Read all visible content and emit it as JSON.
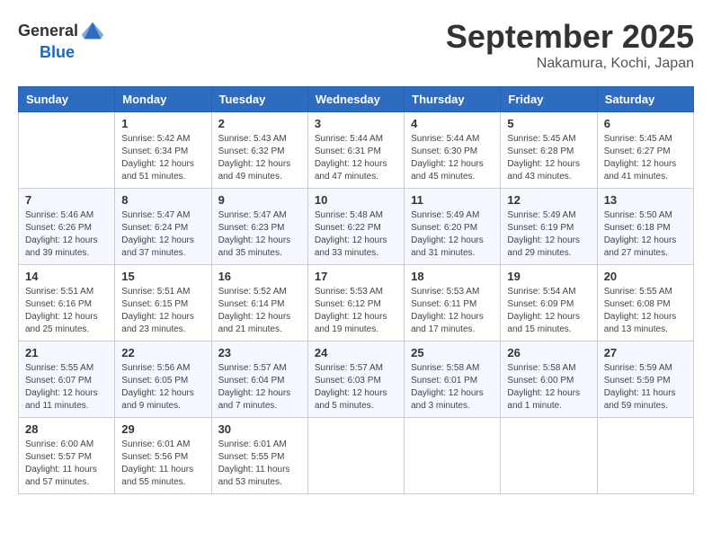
{
  "header": {
    "logo_general": "General",
    "logo_blue": "Blue",
    "month": "September 2025",
    "location": "Nakamura, Kochi, Japan"
  },
  "weekdays": [
    "Sunday",
    "Monday",
    "Tuesday",
    "Wednesday",
    "Thursday",
    "Friday",
    "Saturday"
  ],
  "weeks": [
    [
      {
        "day": "",
        "info": ""
      },
      {
        "day": "1",
        "info": "Sunrise: 5:42 AM\nSunset: 6:34 PM\nDaylight: 12 hours\nand 51 minutes."
      },
      {
        "day": "2",
        "info": "Sunrise: 5:43 AM\nSunset: 6:32 PM\nDaylight: 12 hours\nand 49 minutes."
      },
      {
        "day": "3",
        "info": "Sunrise: 5:44 AM\nSunset: 6:31 PM\nDaylight: 12 hours\nand 47 minutes."
      },
      {
        "day": "4",
        "info": "Sunrise: 5:44 AM\nSunset: 6:30 PM\nDaylight: 12 hours\nand 45 minutes."
      },
      {
        "day": "5",
        "info": "Sunrise: 5:45 AM\nSunset: 6:28 PM\nDaylight: 12 hours\nand 43 minutes."
      },
      {
        "day": "6",
        "info": "Sunrise: 5:45 AM\nSunset: 6:27 PM\nDaylight: 12 hours\nand 41 minutes."
      }
    ],
    [
      {
        "day": "7",
        "info": "Sunrise: 5:46 AM\nSunset: 6:26 PM\nDaylight: 12 hours\nand 39 minutes."
      },
      {
        "day": "8",
        "info": "Sunrise: 5:47 AM\nSunset: 6:24 PM\nDaylight: 12 hours\nand 37 minutes."
      },
      {
        "day": "9",
        "info": "Sunrise: 5:47 AM\nSunset: 6:23 PM\nDaylight: 12 hours\nand 35 minutes."
      },
      {
        "day": "10",
        "info": "Sunrise: 5:48 AM\nSunset: 6:22 PM\nDaylight: 12 hours\nand 33 minutes."
      },
      {
        "day": "11",
        "info": "Sunrise: 5:49 AM\nSunset: 6:20 PM\nDaylight: 12 hours\nand 31 minutes."
      },
      {
        "day": "12",
        "info": "Sunrise: 5:49 AM\nSunset: 6:19 PM\nDaylight: 12 hours\nand 29 minutes."
      },
      {
        "day": "13",
        "info": "Sunrise: 5:50 AM\nSunset: 6:18 PM\nDaylight: 12 hours\nand 27 minutes."
      }
    ],
    [
      {
        "day": "14",
        "info": "Sunrise: 5:51 AM\nSunset: 6:16 PM\nDaylight: 12 hours\nand 25 minutes."
      },
      {
        "day": "15",
        "info": "Sunrise: 5:51 AM\nSunset: 6:15 PM\nDaylight: 12 hours\nand 23 minutes."
      },
      {
        "day": "16",
        "info": "Sunrise: 5:52 AM\nSunset: 6:14 PM\nDaylight: 12 hours\nand 21 minutes."
      },
      {
        "day": "17",
        "info": "Sunrise: 5:53 AM\nSunset: 6:12 PM\nDaylight: 12 hours\nand 19 minutes."
      },
      {
        "day": "18",
        "info": "Sunrise: 5:53 AM\nSunset: 6:11 PM\nDaylight: 12 hours\nand 17 minutes."
      },
      {
        "day": "19",
        "info": "Sunrise: 5:54 AM\nSunset: 6:09 PM\nDaylight: 12 hours\nand 15 minutes."
      },
      {
        "day": "20",
        "info": "Sunrise: 5:55 AM\nSunset: 6:08 PM\nDaylight: 12 hours\nand 13 minutes."
      }
    ],
    [
      {
        "day": "21",
        "info": "Sunrise: 5:55 AM\nSunset: 6:07 PM\nDaylight: 12 hours\nand 11 minutes."
      },
      {
        "day": "22",
        "info": "Sunrise: 5:56 AM\nSunset: 6:05 PM\nDaylight: 12 hours\nand 9 minutes."
      },
      {
        "day": "23",
        "info": "Sunrise: 5:57 AM\nSunset: 6:04 PM\nDaylight: 12 hours\nand 7 minutes."
      },
      {
        "day": "24",
        "info": "Sunrise: 5:57 AM\nSunset: 6:03 PM\nDaylight: 12 hours\nand 5 minutes."
      },
      {
        "day": "25",
        "info": "Sunrise: 5:58 AM\nSunset: 6:01 PM\nDaylight: 12 hours\nand 3 minutes."
      },
      {
        "day": "26",
        "info": "Sunrise: 5:58 AM\nSunset: 6:00 PM\nDaylight: 12 hours\nand 1 minute."
      },
      {
        "day": "27",
        "info": "Sunrise: 5:59 AM\nSunset: 5:59 PM\nDaylight: 11 hours\nand 59 minutes."
      }
    ],
    [
      {
        "day": "28",
        "info": "Sunrise: 6:00 AM\nSunset: 5:57 PM\nDaylight: 11 hours\nand 57 minutes."
      },
      {
        "day": "29",
        "info": "Sunrise: 6:01 AM\nSunset: 5:56 PM\nDaylight: 11 hours\nand 55 minutes."
      },
      {
        "day": "30",
        "info": "Sunrise: 6:01 AM\nSunset: 5:55 PM\nDaylight: 11 hours\nand 53 minutes."
      },
      {
        "day": "",
        "info": ""
      },
      {
        "day": "",
        "info": ""
      },
      {
        "day": "",
        "info": ""
      },
      {
        "day": "",
        "info": ""
      }
    ]
  ]
}
